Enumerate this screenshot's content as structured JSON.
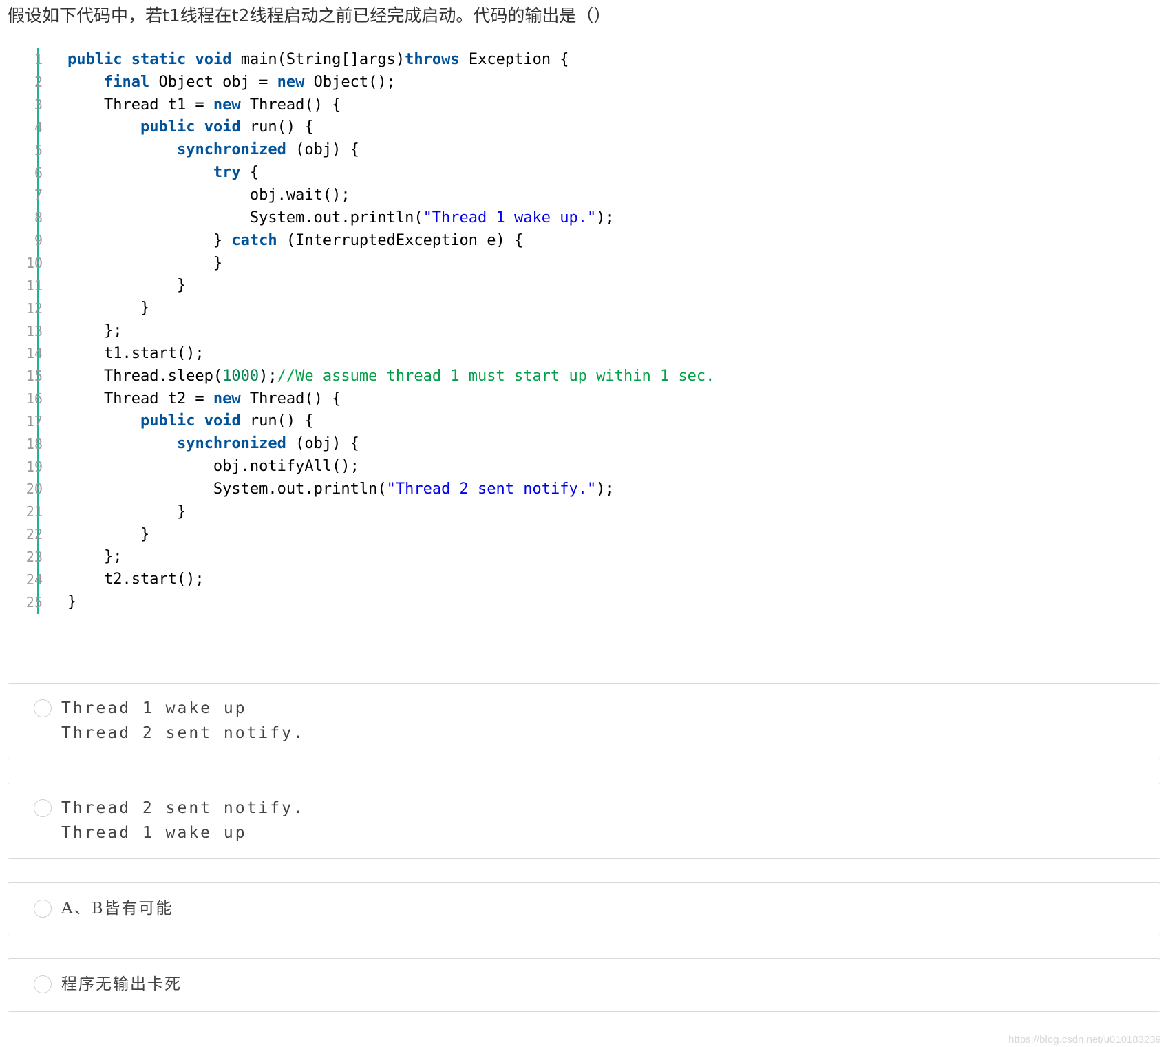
{
  "question": "假设如下代码中，若t1线程在t2线程启动之前已经完成启动。代码的输出是（）",
  "code": {
    "lines": [
      [
        {
          "t": "kw",
          "v": "public"
        },
        {
          "t": "plain",
          "v": " "
        },
        {
          "t": "kw",
          "v": "static"
        },
        {
          "t": "plain",
          "v": " "
        },
        {
          "t": "kw",
          "v": "void"
        },
        {
          "t": "plain",
          "v": " main(String[]args)"
        },
        {
          "t": "kw",
          "v": "throws"
        },
        {
          "t": "plain",
          "v": " Exception {"
        }
      ],
      [
        {
          "t": "plain",
          "v": "    "
        },
        {
          "t": "kw",
          "v": "final"
        },
        {
          "t": "plain",
          "v": " Object obj = "
        },
        {
          "t": "kw",
          "v": "new"
        },
        {
          "t": "plain",
          "v": " Object();"
        }
      ],
      [
        {
          "t": "plain",
          "v": "    Thread t1 = "
        },
        {
          "t": "kw",
          "v": "new"
        },
        {
          "t": "plain",
          "v": " Thread() {"
        }
      ],
      [
        {
          "t": "plain",
          "v": "        "
        },
        {
          "t": "kw",
          "v": "public"
        },
        {
          "t": "plain",
          "v": " "
        },
        {
          "t": "kw",
          "v": "void"
        },
        {
          "t": "plain",
          "v": " run() {"
        }
      ],
      [
        {
          "t": "plain",
          "v": "            "
        },
        {
          "t": "kw",
          "v": "synchronized"
        },
        {
          "t": "plain",
          "v": " (obj) {"
        }
      ],
      [
        {
          "t": "plain",
          "v": "                "
        },
        {
          "t": "kw",
          "v": "try"
        },
        {
          "t": "plain",
          "v": " {"
        }
      ],
      [
        {
          "t": "plain",
          "v": "                    obj.wait();"
        }
      ],
      [
        {
          "t": "plain",
          "v": "                    System.out.println("
        },
        {
          "t": "str",
          "v": "\"Thread 1 wake up.\""
        },
        {
          "t": "plain",
          "v": ");"
        }
      ],
      [
        {
          "t": "plain",
          "v": "                } "
        },
        {
          "t": "kw",
          "v": "catch"
        },
        {
          "t": "plain",
          "v": " (InterruptedException e) {"
        }
      ],
      [
        {
          "t": "plain",
          "v": "                }"
        }
      ],
      [
        {
          "t": "plain",
          "v": "            }"
        }
      ],
      [
        {
          "t": "plain",
          "v": "        }"
        }
      ],
      [
        {
          "t": "plain",
          "v": "    };"
        }
      ],
      [
        {
          "t": "plain",
          "v": "    t1.start();"
        }
      ],
      [
        {
          "t": "plain",
          "v": "    Thread.sleep("
        },
        {
          "t": "num",
          "v": "1000"
        },
        {
          "t": "plain",
          "v": ");"
        },
        {
          "t": "cmt",
          "v": "//We assume thread 1 must start up within 1 sec."
        }
      ],
      [
        {
          "t": "plain",
          "v": "    Thread t2 = "
        },
        {
          "t": "kw",
          "v": "new"
        },
        {
          "t": "plain",
          "v": " Thread() {"
        }
      ],
      [
        {
          "t": "plain",
          "v": "        "
        },
        {
          "t": "kw",
          "v": "public"
        },
        {
          "t": "plain",
          "v": " "
        },
        {
          "t": "kw",
          "v": "void"
        },
        {
          "t": "plain",
          "v": " run() {"
        }
      ],
      [
        {
          "t": "plain",
          "v": "            "
        },
        {
          "t": "kw",
          "v": "synchronized"
        },
        {
          "t": "plain",
          "v": " (obj) {"
        }
      ],
      [
        {
          "t": "plain",
          "v": "                obj.notifyAll();"
        }
      ],
      [
        {
          "t": "plain",
          "v": "                System.out.println("
        },
        {
          "t": "str",
          "v": "\"Thread 2 sent notify.\""
        },
        {
          "t": "plain",
          "v": ");"
        }
      ],
      [
        {
          "t": "plain",
          "v": "            }"
        }
      ],
      [
        {
          "t": "plain",
          "v": "        }"
        }
      ],
      [
        {
          "t": "plain",
          "v": "    };"
        }
      ],
      [
        {
          "t": "plain",
          "v": "    t2.start();"
        }
      ],
      [
        {
          "t": "plain",
          "v": "}"
        }
      ]
    ]
  },
  "options": [
    {
      "lines": [
        "Thread 1 wake up",
        "Thread 2 sent notify."
      ],
      "mono": true
    },
    {
      "lines": [
        "Thread 2 sent notify.",
        "Thread 1 wake up"
      ],
      "mono": true
    },
    {
      "lines": [
        "A、B皆有可能"
      ],
      "mono": false
    },
    {
      "lines": [
        "程序无输出卡死"
      ],
      "mono": false
    }
  ],
  "watermark": "https://blog.csdn.net/u010183239",
  "colors": {
    "accent_bar": "#1ab394",
    "keyword": "#00539b",
    "string": "#0000ee",
    "number": "#098658",
    "comment": "#00a046"
  }
}
